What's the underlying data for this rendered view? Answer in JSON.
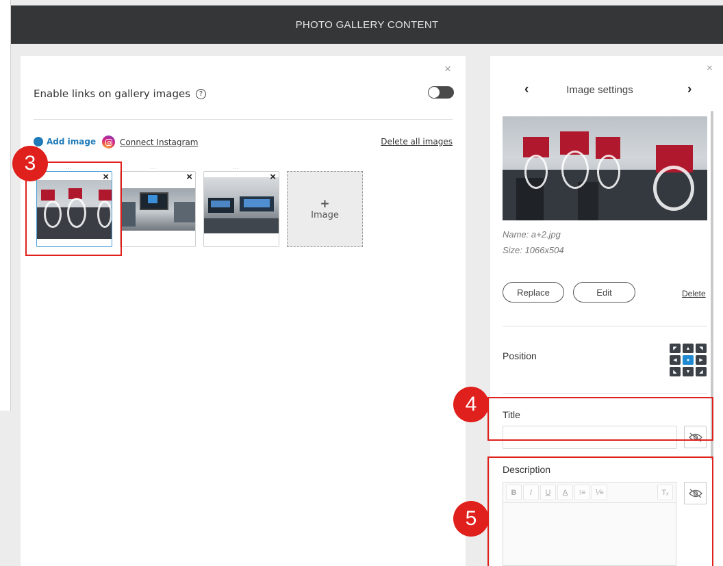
{
  "header": {
    "title": "PHOTO GALLERY CONTENT"
  },
  "gallery": {
    "enable_links_label": "Enable links on gallery images",
    "help_glyph": "?",
    "toggle_state": "off",
    "add_image_label": "Add image",
    "connect_instagram_label": "Connect Instagram",
    "delete_all_label": "Delete all images",
    "add_tile_plus": "+",
    "add_tile_label": "Image",
    "thumb_delete_glyph": "×",
    "drag_handle_glyph": "⋯"
  },
  "settings": {
    "title": "Image settings",
    "prev_glyph": "‹",
    "next_glyph": "›",
    "close_glyph": "×",
    "name_text": "Name: a+2.jpg",
    "size_text": "Size: 1066x504",
    "replace_label": "Replace",
    "edit_label": "Edit",
    "delete_label": "Delete",
    "position_label": "Position",
    "title_label": "Title",
    "description_label": "Description",
    "rte_buttons": [
      "B",
      "I",
      "U",
      "A",
      "⁝≡",
      "⅟≡"
    ],
    "rte_clear": "Tₓ"
  },
  "callouts": [
    "3",
    "4",
    "5"
  ],
  "colors": {
    "topbar": "#343638",
    "accent": "#1f7ab8",
    "callout": "#e0201c"
  }
}
